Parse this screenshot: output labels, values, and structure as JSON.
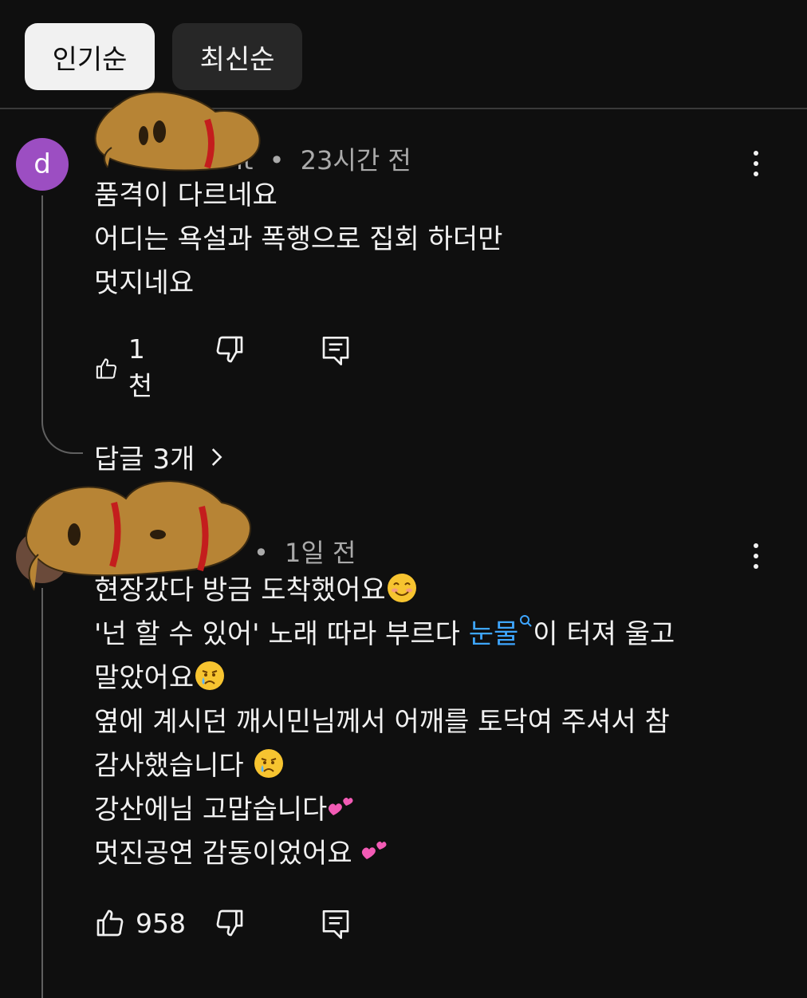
{
  "sort_chips": {
    "popular": "인기순",
    "newest": "최신순"
  },
  "comments": [
    {
      "avatar_letter": "d",
      "avatar_color": "#9c4ec2",
      "author_visible": "it",
      "time": "23시간 전",
      "lines": [
        "품격이 다르네요",
        "어디는 욕설과 폭행으로 집회 하더만",
        "멋지네요"
      ],
      "likes": "1천",
      "replies_label": "답글 3개"
    },
    {
      "time": "1일 전",
      "line1": "현장갔다  방금 도착했어요",
      "line2_a": "'넌 할 수 있어' 노래 따라 부르다 ",
      "line2_link": "눈물",
      "line2_b": "이 터져 울고",
      "line3": "말았어요",
      "line4": "옆에 계시던 깨시민님께서 어깨를 토닥여 주셔서 참",
      "line5": "감사했습니다 ",
      "line6": "강산에님 고맙습니다",
      "line7": "멋진공연 감동이었어요 ",
      "likes": "958"
    }
  ],
  "separator": "•",
  "icons": {
    "like": "thumbs-up-icon",
    "dislike": "thumbs-down-icon",
    "reply": "comment-reply-icon",
    "more": "more-vertical-icon",
    "chevron": "chevron-right-icon",
    "search": "search-icon"
  },
  "colors": {
    "background": "#0f0f0f",
    "link": "#3ea6ff",
    "chip_active": "#f1f1f1",
    "chip_inactive": "#272727"
  }
}
